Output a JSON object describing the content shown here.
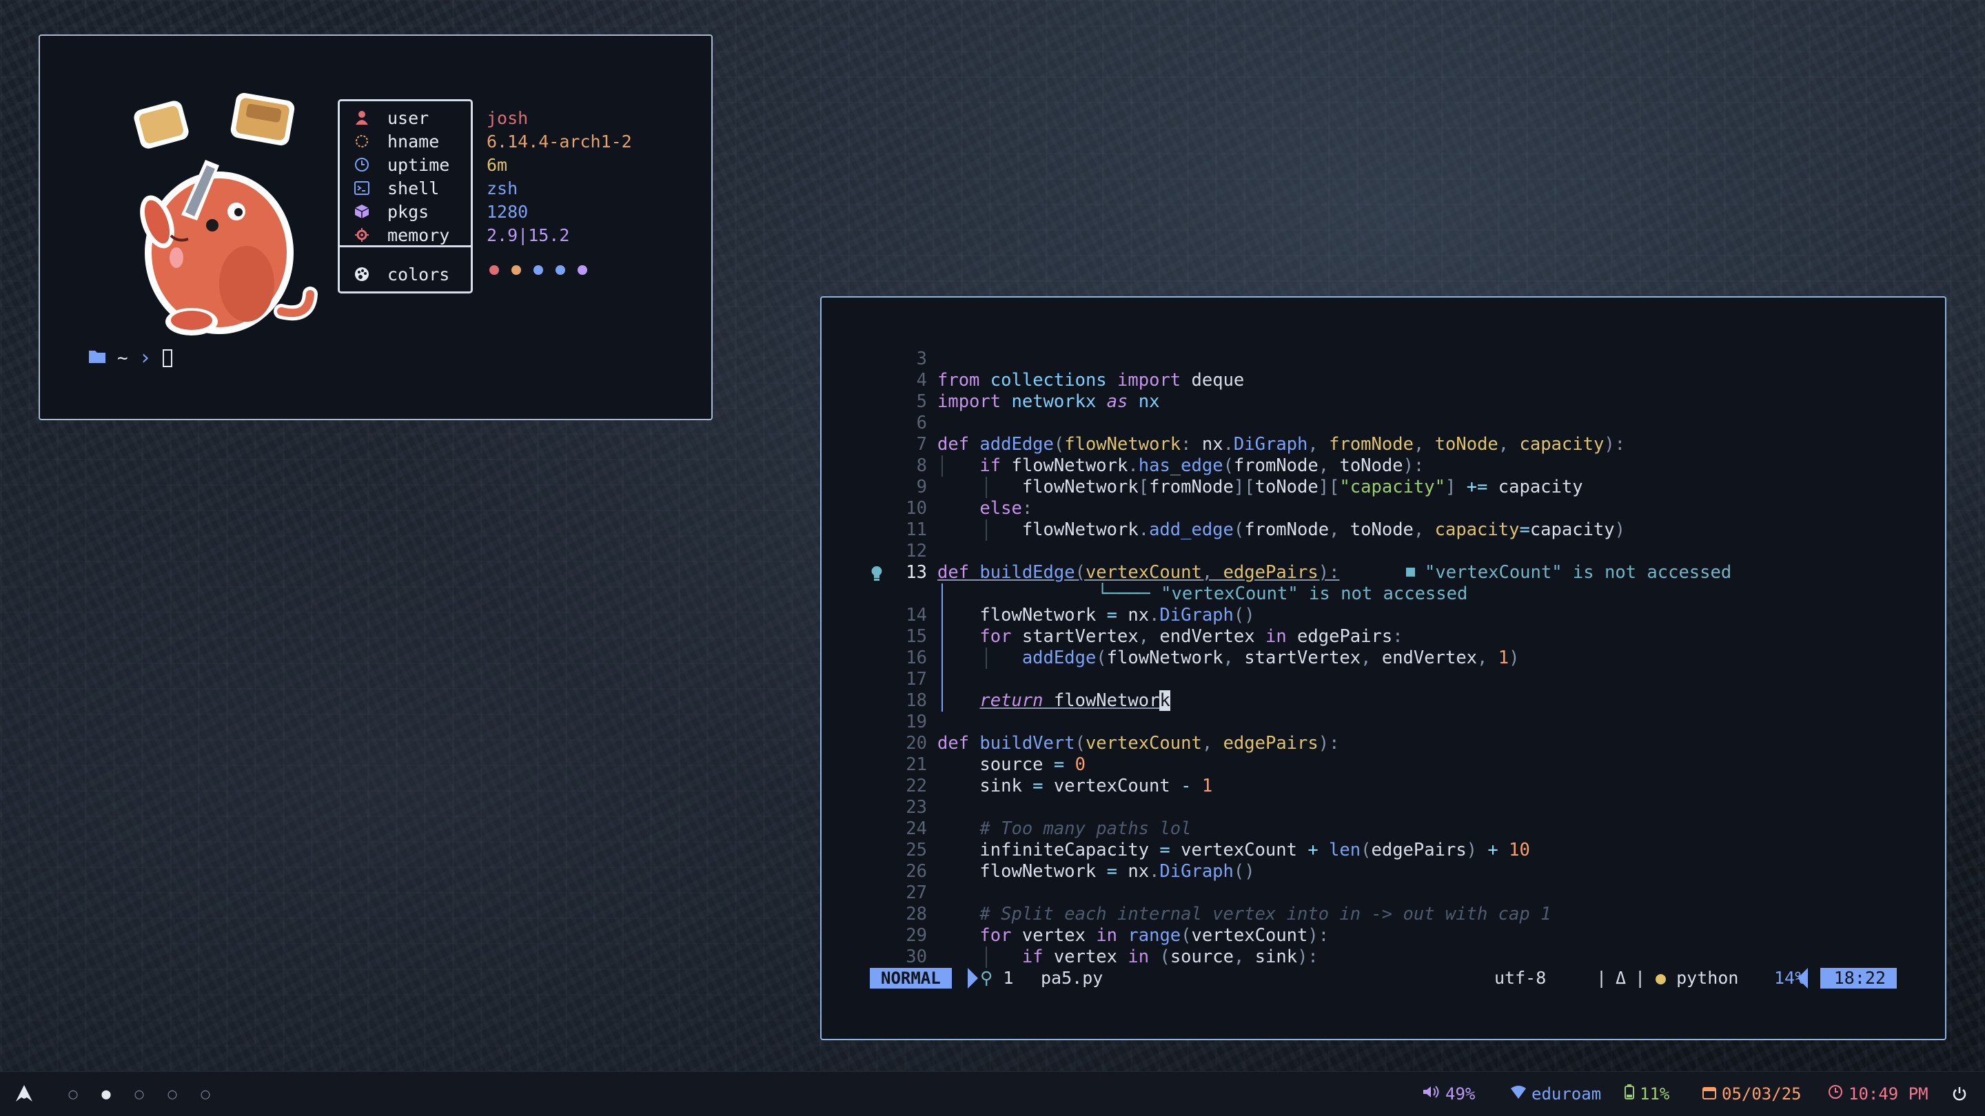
{
  "fetch": {
    "rows": [
      {
        "label": "user",
        "value": "josh",
        "icon": "user-icon",
        "icon_color": "#e06c75",
        "value_color": "#e06c75"
      },
      {
        "label": "hname",
        "value": "6.14.4-arch1-2",
        "icon": "circle-icon",
        "icon_color": "#e5a36b",
        "value_color": "#e5a36b"
      },
      {
        "label": "uptime",
        "value": "6m",
        "icon": "clock-icon",
        "icon_color": "#7aa2f7",
        "value_color": "#e0c26b"
      },
      {
        "label": "shell",
        "value": "zsh",
        "icon": "terminal-icon",
        "icon_color": "#7aa2f7",
        "value_color": "#7aa2f7"
      },
      {
        "label": "pkgs",
        "value": "1280",
        "icon": "package-icon",
        "icon_color": "#bb9af7",
        "value_color": "#7aa2f7"
      },
      {
        "label": "memory",
        "value": "2.9|15.2",
        "icon": "memory-icon",
        "icon_color": "#e06c75",
        "value_color": "#bb9af7"
      }
    ],
    "colors_label": "colors",
    "palette": [
      "#e06c75",
      "#e5a36b",
      "#7aa2f7",
      "#7aa2f7",
      "#bb9af7"
    ],
    "prompt_path": "~"
  },
  "editor": {
    "lines": [
      {
        "n": "3",
        "html": ""
      },
      {
        "n": "4",
        "html": "<span class='kw'>from</span> <span class='mod'>collections</span> <span class='kw'>import</span> deque"
      },
      {
        "n": "5",
        "html": "<span class='kw'>import</span> <span class='mod'>networkx</span> <span class='kw it'>as</span> <span class='mod'>nx</span>"
      },
      {
        "n": "6",
        "html": ""
      },
      {
        "n": "7",
        "html": "<span class='kw'>def</span> <span class='fn'>addEdge</span><span class='punc'>(</span><span class='param'>flowNetwork</span><span class='punc'>:</span> nx<span class='punc'>.</span><span class='fn'>DiGraph</span><span class='punc'>,</span> <span class='param'>fromNode</span><span class='punc'>,</span> <span class='param'>toNode</span><span class='punc'>,</span> <span class='param'>capacity</span><span class='punc'>):</span>"
      },
      {
        "n": "8",
        "html": "    <span class='kw'>if</span> flowNetwork<span class='punc'>.</span><span class='fn'>has_edge</span><span class='punc'>(</span>fromNode<span class='punc'>,</span> toNode<span class='punc'>):</span>"
      },
      {
        "n": "9",
        "html": "        flowNetwork<span class='punc'>[</span>fromNode<span class='punc'>][</span>toNode<span class='punc'>][</span><span class='str'>\"capacity\"</span><span class='punc'>]</span> <span class='op'>+=</span> capacity"
      },
      {
        "n": "10",
        "html": "    <span class='kw'>else</span><span class='punc'>:</span>"
      },
      {
        "n": "11",
        "html": "        flowNetwork<span class='punc'>.</span><span class='fn'>add_edge</span><span class='punc'>(</span>fromNode<span class='punc'>,</span> toNode<span class='punc'>,</span> <span class='param'>capacity</span><span class='op'>=</span>capacity<span class='punc'>)</span>"
      },
      {
        "n": "12",
        "html": ""
      },
      {
        "n": "13",
        "html": "<span class='kw ul'>def</span><span class='ul'> </span><span class='fn ul'>buildEdge</span><span class='punc ul'>(</span><span class='param ul'>vertexCount</span><span class='punc ul'>,</span><span class='ul'> </span><span class='param ul'>edgePairs</span><span class='punc ul'>):</span>",
        "current": true
      },
      {
        "n": "",
        "html": ""
      },
      {
        "n": "14",
        "html": "    flowNetwork <span class='op'>=</span> nx<span class='punc'>.</span><span class='fn'>DiGraph</span><span class='punc'>()</span>"
      },
      {
        "n": "15",
        "html": "    <span class='kw'>for</span> startVertex<span class='punc'>,</span> endVertex <span class='kw'>in</span> edgePairs<span class='punc'>:</span>"
      },
      {
        "n": "16",
        "html": "        <span class='fn'>addEdge</span><span class='punc'>(</span>flowNetwork<span class='punc'>,</span> startVertex<span class='punc'>,</span> endVertex<span class='punc'>,</span> <span class='num'>1</span><span class='punc'>)</span>"
      },
      {
        "n": "17",
        "html": ""
      },
      {
        "n": "18",
        "html": "    <span class='kw it ul'>return</span><span class='ul'> flowNetwor</span><span class='cursorch'>k</span>"
      },
      {
        "n": "19",
        "html": ""
      },
      {
        "n": "20",
        "html": "<span class='kw'>def</span> <span class='fn'>buildVert</span><span class='punc'>(</span><span class='param'>vertexCount</span><span class='punc'>,</span> <span class='param'>edgePairs</span><span class='punc'>):</span>"
      },
      {
        "n": "21",
        "html": "    source <span class='op'>=</span> <span class='num'>0</span>"
      },
      {
        "n": "22",
        "html": "    sink <span class='op'>=</span> vertexCount <span class='op'>-</span> <span class='num'>1</span>"
      },
      {
        "n": "23",
        "html": ""
      },
      {
        "n": "24",
        "html": "    <span class='cmt'># Too many paths lol</span>"
      },
      {
        "n": "25",
        "html": "    infiniteCapacity <span class='op'>=</span> vertexCount <span class='op'>+</span> <span class='fn'>len</span><span class='punc'>(</span>edgePairs<span class='punc'>)</span> <span class='op'>+</span> <span class='num'>10</span>"
      },
      {
        "n": "26",
        "html": "    flowNetwork <span class='op'>=</span> nx<span class='punc'>.</span><span class='fn'>DiGraph</span><span class='punc'>()</span>"
      },
      {
        "n": "27",
        "html": ""
      },
      {
        "n": "28",
        "html": "    <span class='cmt'># Split each internal vertex into in -&gt; out with cap 1</span>"
      },
      {
        "n": "29",
        "html": "    <span class='kw'>for</span> vertex <span class='kw'>in</span> <span class='fn'>range</span><span class='punc'>(</span>vertexCount<span class='punc'>):</span>"
      },
      {
        "n": "30",
        "html": "        <span class='kw'>if</span> vertex <span class='kw'>in</span> <span class='punc'>(</span>source<span class='punc'>,</span> sink<span class='punc'>):</span>"
      }
    ],
    "diagnostic_inline": "\"vertexCount\" is not accessed",
    "diagnostic_below": "\"vertexCount\" is not accessed",
    "status": {
      "mode": "NORMAL",
      "diag_count": "1",
      "filename": "pa5.py",
      "encoding": "utf-8",
      "separator": "|",
      "delta_glyph": "Δ",
      "filetype": "python",
      "percent": "14%",
      "position": "18:22"
    }
  },
  "bar": {
    "workspaces": [
      false,
      true,
      false,
      false,
      false
    ],
    "volume": "49%",
    "wifi": "eduroam",
    "battery": "11%",
    "date": "05/03/25",
    "time": "10:49 PM"
  }
}
